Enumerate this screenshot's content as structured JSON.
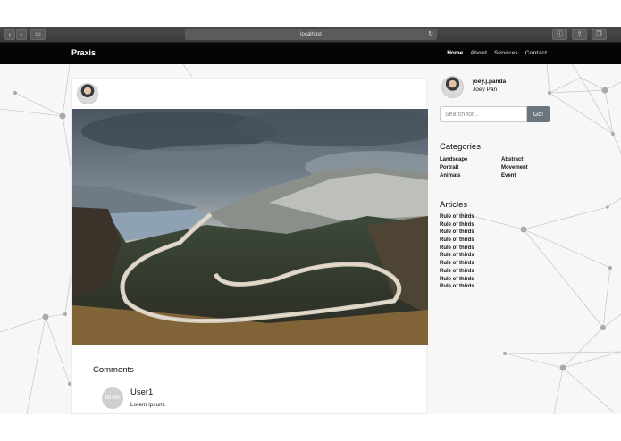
{
  "browser": {
    "url": "localhost",
    "back_icon": "chevron-left-icon",
    "forward_icon": "chevron-right-icon",
    "sidebar_icon": "sidebar-icon",
    "reload_icon": "reload-icon",
    "info_icon": "info-icon",
    "share_icon": "share-icon",
    "tabs_icon": "tabs-icon"
  },
  "navbar": {
    "brand": "Praxis",
    "links": [
      "Home",
      "About",
      "Services",
      "Contact"
    ],
    "active": "Home"
  },
  "post": {
    "comments_title": "Comments",
    "comment": {
      "avatar_text": "60×60",
      "user": "User1",
      "text": "Lorem ipsum."
    }
  },
  "sidebar": {
    "handle": "joey.j.panda",
    "name": "Joey Pan",
    "search_placeholder": "Search for...",
    "search_button": "Go!",
    "categories_title": "Categories",
    "categories_left": [
      "Landscape",
      "Portrait",
      "Animals"
    ],
    "categories_right": [
      "Abstract",
      "Movement",
      "Event"
    ],
    "articles_title": "Articles",
    "articles": [
      "Rule of thirds",
      "Rule of thirds",
      "Rule of thirds",
      "Rule of thirds",
      "Rule of thirds",
      "Rule of thirds",
      "Rule of thirds",
      "Rule of thirds",
      "Rule of thirds",
      "Rule of thirds"
    ]
  },
  "colors": {
    "navbar_bg": "#050505",
    "page_bg": "#f7f7f7",
    "go_button": "#6c757d"
  }
}
